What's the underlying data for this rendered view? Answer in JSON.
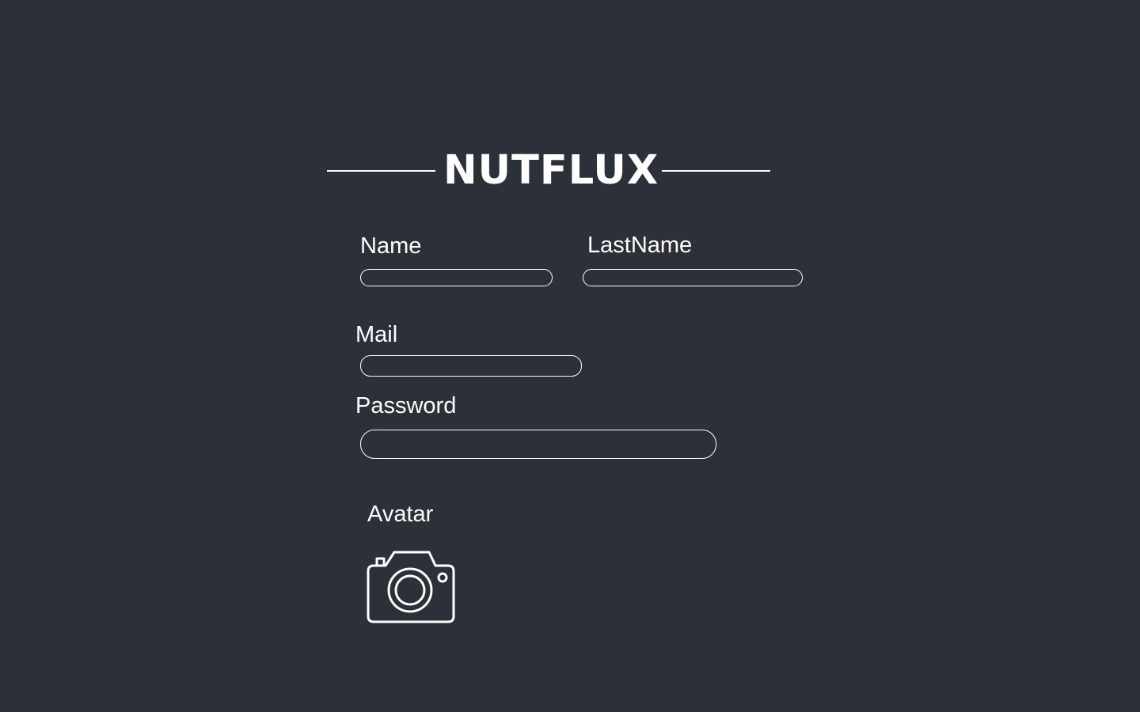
{
  "header": {
    "title": "NUTFLUX"
  },
  "form": {
    "name": {
      "label": "Name",
      "value": ""
    },
    "lastname": {
      "label": "LastName",
      "value": ""
    },
    "mail": {
      "label": "Mail",
      "value": ""
    },
    "password": {
      "label": "Password",
      "value": ""
    },
    "avatar": {
      "label": "Avatar",
      "icon": "camera-icon"
    }
  }
}
